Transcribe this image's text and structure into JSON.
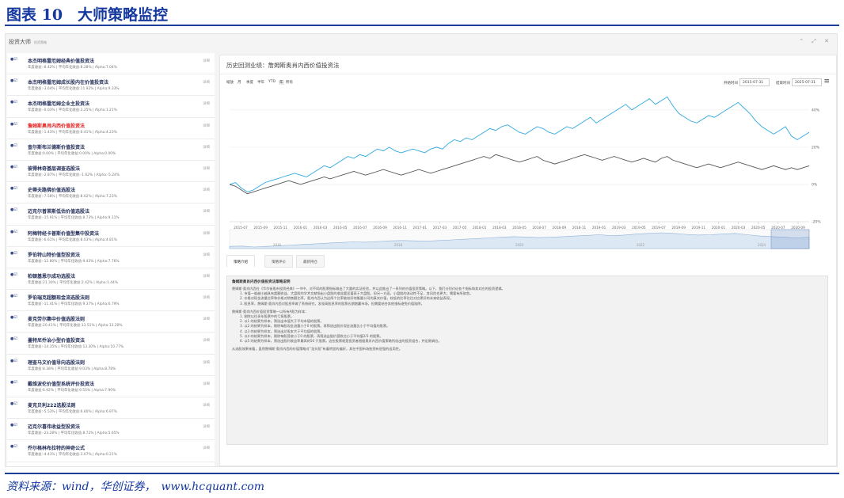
{
  "figure": {
    "title": "图表 10　大师策略监控",
    "source": "资料来源：wind，华创证券，　www.hcquant.com"
  },
  "app": {
    "title": "投资大师",
    "subtitle": "投资策略",
    "window_controls": "⌃ ⤢ ✕"
  },
  "sidebar": {
    "link_label": "详细",
    "items": [
      {
        "name": "本杰明格雷厄姆经典价值投资法",
        "stats": "年度收益:-8.42% | 平均年化收益:8.28% | Alpha:7.04%",
        "active": false
      },
      {
        "name": "本杰明格雷厄姆成长股内在价值投资法",
        "stats": "年度收益:-3.64% | 平均年化收益:11.92% | Alpha:9.33%",
        "active": false
      },
      {
        "name": "本杰明格雷厄姆企业主投资法",
        "stats": "年度收益:-0.03% | 平均年化收益:3.25% | Alpha:1.21%",
        "active": false
      },
      {
        "name": "詹姆斯奥肖内西价值投资法",
        "stats": "年度收益:-1.43% | 平均年化收益:6.41% | Alpha:4.23%",
        "active": true
      },
      {
        "name": "查尔斯布兰德斯价值投资法",
        "stats": "年度收益:0.00% | 平均年化收益:0.00% | Alpha:0.00%",
        "active": false
      },
      {
        "name": "彼得林奇基层调查选股法",
        "stats": "年度收益:-2.87% | 平均年化收益:-1.62% | Alpha:-5.24%",
        "active": false
      },
      {
        "name": "史蒂夫路佛价值选股法",
        "stats": "年度收益:-7.58% | 平均年化收益:8.02% | Alpha:7.23%",
        "active": false
      },
      {
        "name": "迈克尔普莱斯低估价值选股法",
        "stats": "年度收益:-15.91% | 平均年化收益:8.73% | Alpha:9.11%",
        "active": false
      },
      {
        "name": "阿梅特经卡普斯价值型集中投资法",
        "stats": "年度收益:-6.61% | 平均年化收益:8.03% | Alpha:4.81%",
        "active": false
      },
      {
        "name": "罗伯特山特价值型投资法",
        "stats": "年度收益:-12.80% | 平均年化收益:9.43% | Alpha:7.76%",
        "active": false
      },
      {
        "name": "柏顿基恩尔成功选股法",
        "stats": "年度收益:21.30% | 平均年化收益:2.42% | Alpha:1.44%",
        "active": false
      },
      {
        "name": "罗伯瑞克超额现金流选股法则",
        "stats": "年度收益:-11.41% | 平均年化收益:9.37% | Alpha:6.79%",
        "active": false
      },
      {
        "name": "麦克劳尔集中价值选股法则",
        "stats": "年度收益:20.41% | 平均年化收益:13.51% | Alpha:13.20%",
        "active": false
      },
      {
        "name": "墨特尼乔治小型价值投资法",
        "stats": "年度收益:-14.35% | 平均年化收益:13.30% | Alpha:10.77%",
        "active": false
      },
      {
        "name": "理查马文价值导向选股法则",
        "stats": "年度收益:8.38% | 平均年化收益:9.03% | Alpha:8.78%",
        "active": false
      },
      {
        "name": "戴维波伦价值型系统评价投资法",
        "stats": "年度收益:6.92% | 平均年化收益:9.55% | Alpha:7.90%",
        "active": false
      },
      {
        "name": "麦克贝利222选股法则",
        "stats": "年度收益:-5.53% | 平均年化收益:6.60% | Alpha:6.97%",
        "active": false
      },
      {
        "name": "迈克尔喜伟收益型投资法",
        "stats": "年度收益:-23.28% | 平均年化收益:8.72% | Alpha:5.65%",
        "active": false
      },
      {
        "name": "乔尔格林布拉特的神奇公式",
        "stats": "年度收益:-4.43% | 平均年化收益:3.07% | Alpha:0.21%",
        "active": false
      }
    ]
  },
  "main": {
    "title": "历史回测业绩：詹姆斯奥肖内西价值投资法",
    "zoom_label": "缩放",
    "zoom_options": [
      "月",
      "季度",
      "半年",
      "YTD",
      "年",
      "所有"
    ],
    "start_label": "开始时间",
    "start_value": "2015-07-31",
    "end_label": "结束时间",
    "end_value": "2025-07-31",
    "menu_icon": "≡",
    "tabs": [
      "策略介绍",
      "策略评价",
      "最新持仓"
    ],
    "desc_title": "詹姆斯奥肖内西价值投资法策略说明",
    "desc_lines": [
      {
        "t": "詹姆斯·奥肖内西在《华尔街股市投资经典》一书中，对不同的股票指标做出了大量的实证检验，并以此推出了一系列的价值投资策略。以下，我们分别讨论各个指标和其对应的投资逻辑。",
        "ind": false
      },
      {
        "t": "1. 市值一般越小越具有超额收益，大盘股的学术文献指出小盘股的收益要显著高于大盘股。但另一方面，小盘股的流动性不足，其风险也更大，需要有所取舍。",
        "ind": true
      },
      {
        "t": "2. 价格对现金流量比率和价格对销售额比率，奥肖内西认为这两个比率能较好地衡量公司的真实价值，较低的比率往往对应更好的未来收益表现。",
        "ind": true
      },
      {
        "t": "3. 股息率，詹姆斯·奥肖内西对股息率做了系统研究，发现高股息率的股票长期跑赢市场，但需要结合其他指标避免价值陷阱。",
        "ind": true
      },
      {
        "t": "",
        "gap": true
      },
      {
        "t": "詹姆斯·奥肖内西价值投资策略一以所有A股为样本：",
        "ind": false
      },
      {
        "t": "1. 剔除以往多年股票中的亏损股票。",
        "ind": true
      },
      {
        "t": "2. 以1 的结果为样本，筛选出市值大于平均市值的股票。",
        "ind": true
      },
      {
        "t": "3. 以2 的结果为样本，剔除每股现金流量小于0 的股票。再筛选出股价现金流量比小于平均值的股票。",
        "ind": true
      },
      {
        "t": "4. 以3 的结果为样本，筛选出总股本大于平均值的股票。",
        "ind": true
      },
      {
        "t": "5. 以4 的结果为样本，剔除每股营收小于0 的股票，再筛选出股价营收比小于平均值2/3 的股票。",
        "ind": true
      },
      {
        "t": "6. 以5 的结果为样本，筛选出股利收益率最高的50 只股票。这些股票就是投资者根据奥肖内西价值策略所选出的投资组合，并定期调仓。",
        "ind": true
      },
      {
        "t": "",
        "gap": true
      },
      {
        "t": "从选股效果来看，虽然詹姆斯·奥肖内西的价值策略对“龙头股”有着明显的偏好，其在中国市场依然有很强的适用性。",
        "ind": false
      }
    ]
  },
  "chart_data": {
    "type": "line",
    "title": "",
    "xlabel": "",
    "ylabel": "",
    "x_ticks": [
      "2015-07",
      "2015-09",
      "2015-11",
      "2016-01",
      "2016-03",
      "2016-05",
      "2016-07",
      "2016-09",
      "2016-11",
      "2017-01",
      "2017-03",
      "2017-05",
      "2018-01",
      "2018-03",
      "2018-05",
      "2018-07",
      "2018-09",
      "2018-11",
      "2019-01",
      "2019-03",
      "2019-05",
      "2019-07",
      "2019-09",
      "2019-11",
      "2020-01",
      "2020-03",
      "2020-05",
      "2020-07",
      "2020-09"
    ],
    "y_ticks": [
      "-20%",
      "0%",
      "20%",
      "40%"
    ],
    "ylim": [
      -20,
      48
    ],
    "nav_ticks": [
      "2016",
      "2018",
      "2020",
      "2022",
      "2024"
    ],
    "grid": true,
    "series": [
      {
        "name": "",
        "color": "#2fa8e0",
        "values": [
          0,
          1,
          -2,
          -4,
          -3,
          -1,
          1,
          2,
          3,
          4,
          5,
          6,
          5,
          4,
          6,
          8,
          10,
          9,
          11,
          13,
          15,
          14,
          16,
          15,
          17,
          19,
          18,
          20,
          18,
          17,
          18,
          19,
          18,
          17,
          19,
          20,
          19,
          22,
          24,
          23,
          25,
          24,
          26,
          28,
          30,
          29,
          31,
          32,
          30,
          28,
          27,
          29,
          31,
          30,
          28,
          27,
          29,
          31,
          30,
          32,
          34,
          36,
          33,
          35,
          37,
          39,
          41,
          43,
          40,
          42,
          44,
          46,
          43,
          45,
          47,
          42,
          38,
          36,
          34,
          33,
          35,
          37,
          36,
          38,
          40,
          42,
          44,
          41,
          38,
          34,
          31,
          29,
          27,
          29,
          31,
          26,
          24,
          26,
          28
        ]
      },
      {
        "name": "",
        "color": "#555555",
        "values": [
          0,
          -1,
          -3,
          -5,
          -4,
          -3,
          -2,
          -1,
          0,
          1,
          2,
          1,
          0,
          1,
          2,
          3,
          4,
          3,
          4,
          5,
          6,
          7,
          6,
          5,
          6,
          7,
          8,
          7,
          6,
          5,
          6,
          7,
          8,
          7,
          6,
          7,
          8,
          9,
          10,
          11,
          12,
          13,
          14,
          15,
          14,
          16,
          15,
          14,
          13,
          12,
          13,
          14,
          15,
          13,
          12,
          11,
          12,
          13,
          14,
          15,
          16,
          15,
          14,
          13,
          14,
          15,
          14,
          13,
          12,
          13,
          14,
          13,
          12,
          14,
          15,
          13,
          12,
          11,
          10,
          9,
          10,
          11,
          10,
          9,
          10,
          11,
          12,
          11,
          10,
          9,
          8,
          9,
          10,
          9,
          8,
          9,
          8,
          9,
          10
        ]
      }
    ],
    "nav_series": [
      0,
      1,
      -2,
      0,
      2,
      4,
      6,
      8,
      10,
      12,
      14,
      13,
      15,
      17,
      18,
      17,
      16,
      18,
      20,
      22,
      24,
      26,
      28,
      30,
      29,
      27,
      28,
      30,
      32,
      34,
      36,
      33,
      35,
      38,
      40,
      42,
      40,
      37,
      35,
      36,
      38,
      40,
      36,
      32,
      30,
      28,
      26,
      28
    ]
  }
}
